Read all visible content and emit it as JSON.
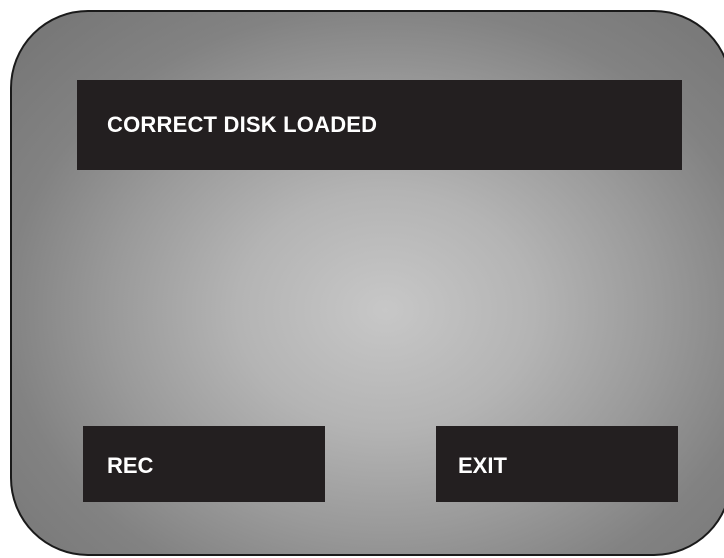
{
  "screen": {
    "message": "CORRECT DISK LOADED",
    "buttons": {
      "rec_label": "REC",
      "exit_label": "EXIT"
    }
  },
  "colors": {
    "panel": "#231f20",
    "text": "#ffffff",
    "screen_center": "#c7c7c7",
    "screen_edge": "#747474"
  }
}
